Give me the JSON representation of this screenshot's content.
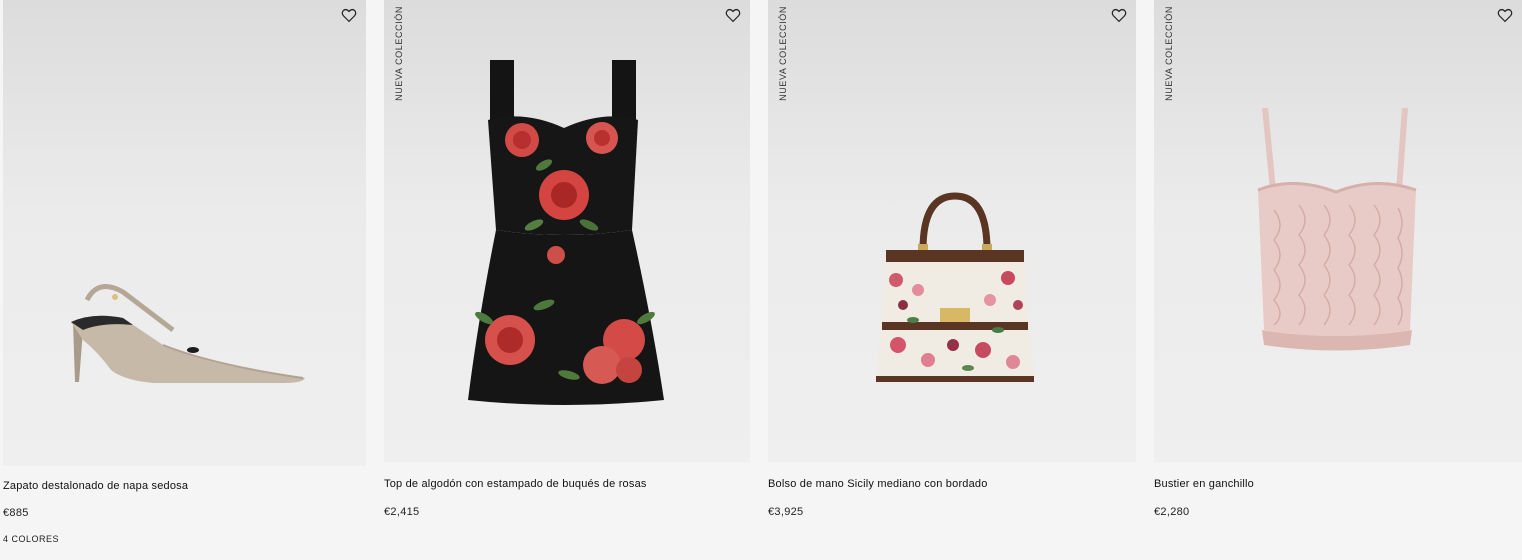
{
  "products": [
    {
      "name": "Zapato destalonado de napa sedosa",
      "price": "€885",
      "colors": "4 COLORES",
      "badge": "",
      "image": "slingback-pump-icon"
    },
    {
      "name": "Top de algodón con estampado de buqués de rosas",
      "price": "€2,415",
      "badge": "NUEVA COLECCIÓN",
      "image": "floral-dress-icon"
    },
    {
      "name": "Bolso de mano Sicily mediano con bordado",
      "price": "€3,925",
      "badge": "NUEVA COLECCIÓN",
      "image": "handbag-icon"
    },
    {
      "name": "Bustier en ganchillo",
      "price": "€2,280",
      "badge": "NUEVA COLECCIÓN",
      "image": "crochet-bustier-icon"
    }
  ],
  "colors": {
    "background": "#f5f5f5",
    "text": "#111111"
  }
}
